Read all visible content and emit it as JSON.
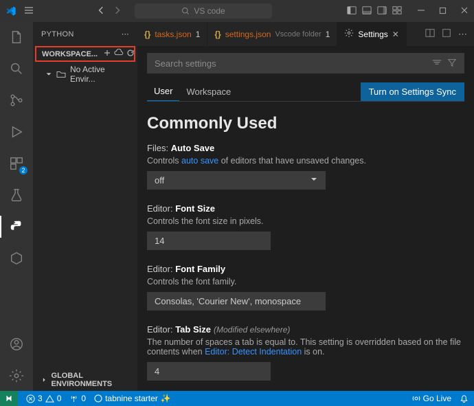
{
  "titlebar": {
    "search_placeholder": "VS code"
  },
  "sidebar": {
    "title": "PYTHON",
    "workspace_label": "WORKSPACE...",
    "no_env_label": "No Active Envir...",
    "global_env_label": "GLOBAL ENVIRONMENTS"
  },
  "activity_badge": "2",
  "tabs": {
    "t1": {
      "name": "tasks.json",
      "dot": "1"
    },
    "t2": {
      "name": "settings.json",
      "folder": "Vscode folder",
      "dot": "1"
    },
    "t3": {
      "label": "Settings"
    }
  },
  "settings": {
    "search_placeholder": "Search settings",
    "scope_user": "User",
    "scope_workspace": "Workspace",
    "sync_label": "Turn on Settings Sync",
    "section_title": "Commonly Used",
    "autosave": {
      "prefix": "Files:",
      "name": "Auto Save",
      "desc_pre": "Controls ",
      "desc_link": "auto save",
      "desc_post": " of editors that have unsaved changes.",
      "value": "off"
    },
    "fontsize": {
      "prefix": "Editor:",
      "name": "Font Size",
      "desc": "Controls the font size in pixels.",
      "value": "14"
    },
    "fontfamily": {
      "prefix": "Editor:",
      "name": "Font Family",
      "desc": "Controls the font family.",
      "value": "Consolas, 'Courier New', monospace"
    },
    "tabsize": {
      "prefix": "Editor:",
      "name": "Tab Size",
      "hint": "(Modified elsewhere)",
      "desc_pre": "The number of spaces a tab is equal to. This setting is overridden based on the file contents when ",
      "desc_link": "Editor: Detect Indentation",
      "desc_post": " is on.",
      "value": "4"
    }
  },
  "statusbar": {
    "errors": "3",
    "warnings": "0",
    "ports": "0",
    "tabnine": "tabnine starter",
    "golive": "Go Live"
  }
}
